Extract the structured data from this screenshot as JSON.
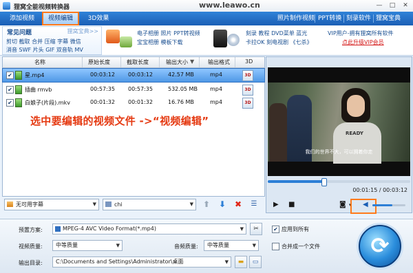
{
  "window": {
    "title": "狸窝全能视频转换器",
    "site": "www.leawo.cn",
    "controls": [
      "—",
      "□",
      "✕"
    ]
  },
  "tabs": [
    {
      "label": "添加视频"
    },
    {
      "label": "视频编辑",
      "active": true
    },
    {
      "label": "3D效果"
    }
  ],
  "right_menu": [
    "照片制作视频",
    "PPT转换",
    "刻录软件",
    "狸窝宝典"
  ],
  "faq": {
    "title": "常见问题",
    "more": "狸窝宝典>>",
    "row1": "剪切 截取 合并 压缩 字幕 微信",
    "row2": "消音 SWF 片头 GIF 双音轨 MV"
  },
  "promo": {
    "group1_line1": "电子相册 照片 PPT转视频",
    "group1_line2": "宝宝相册 模板下载",
    "group2_line1": "刻录 教程 DVD菜单 蓝光",
    "group2_line2": "卡拉OK 刻电视剧 《七杀》",
    "vip_line1": "VIP用户-拥有狸窝所有软件",
    "vip_line2": "点此升级VIP会员"
  },
  "table": {
    "headers": [
      "名称",
      "原始长度",
      "截取长度",
      "输出大小",
      "输出格式",
      "3D"
    ],
    "rows": [
      {
        "name": "星.mp4",
        "orig": "00:03:12",
        "cut": "00:03:12",
        "size": "42.57 MB",
        "fmt": "mp4",
        "selected": true
      },
      {
        "name": "插曲 rmvb",
        "orig": "00:57:35",
        "cut": "00:57:35",
        "size": "532.05 MB",
        "fmt": "mp4",
        "selected": false
      },
      {
        "name": "白娘子(片段).mkv",
        "orig": "00:01:32",
        "cut": "00:01:32",
        "size": "16.76 MB",
        "fmt": "mp4",
        "selected": false
      }
    ]
  },
  "overlay_text": "选中要编辑的视频文件 ->“视频编辑”",
  "preview": {
    "subtitle": "我们的世界不大，可以拥着你走",
    "shirt_text": "READY",
    "time": "00:01:15 / 00:03:12",
    "progress": 0.39,
    "volume": 0.6
  },
  "list_controls": {
    "subtitle_value": "无可用字幕",
    "audio_value": "chi"
  },
  "bottom": {
    "preset_label": "预置方案:",
    "preset_value": "MPEG-4 AVC Video Format(*.mp4)",
    "apply_all": "应用到所有",
    "apply_all_checked": true,
    "video_quality_label": "视频质量:",
    "video_quality_value": "中等质量",
    "audio_quality_label": "音频质量:",
    "audio_quality_value": "中等质量",
    "merge_label": "合并成一个文件",
    "merge_checked": false,
    "output_label": "输出目录:",
    "output_value": "C:\\Documents and Settings\\Administrator\\桌面"
  },
  "colors": {
    "accent": "#1c5fb5",
    "highlight": "#ff7a1a",
    "overlay": "#e53a12"
  }
}
